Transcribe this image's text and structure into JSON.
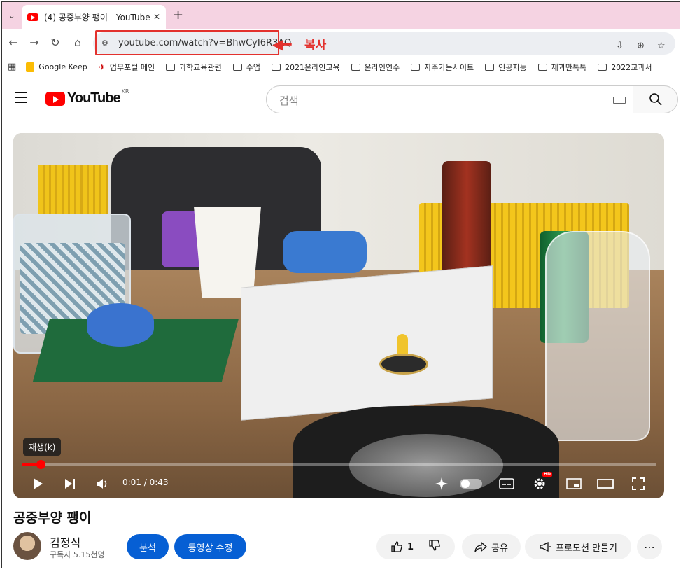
{
  "browser": {
    "tab_title": "(4) 공중부양 팽이 - YouTube",
    "tab_close": "✕",
    "new_tab": "+",
    "url": "youtube.com/watch?v=BhwCyI6R3AQ",
    "annotation": {
      "arrow": "◀━",
      "label": "복사",
      "color": "#e3312d"
    },
    "bookmarks": [
      {
        "label": "Google Keep",
        "icon": "keep-icon"
      },
      {
        "label": "업무포털 메인",
        "icon": "pin-icon"
      },
      {
        "label": "과학교육관련",
        "icon": "folder-icon"
      },
      {
        "label": "수업",
        "icon": "folder-icon"
      },
      {
        "label": "2021온라인교육",
        "icon": "folder-icon"
      },
      {
        "label": "온라인연수",
        "icon": "folder-icon"
      },
      {
        "label": "자주가는사이트",
        "icon": "folder-icon"
      },
      {
        "label": "인공지능",
        "icon": "folder-icon"
      },
      {
        "label": "재과만톡톡",
        "icon": "folder-icon"
      },
      {
        "label": "2022교과서",
        "icon": "folder-icon"
      }
    ]
  },
  "youtube": {
    "logo_text": "YouTube",
    "region": "KR",
    "search_placeholder": "검색",
    "brand_color": "#ff0000"
  },
  "player": {
    "tooltip": "재생(k)",
    "time": "0:01 / 0:43",
    "progress_fraction": 0.03,
    "hd_badge": "HD"
  },
  "video": {
    "title": "공중부양 팽이",
    "channel": "김정식",
    "subscribers": "구독자 5.15천명",
    "buttons": {
      "analytics": "분석",
      "edit": "동영상 수정",
      "like_count": "1",
      "share": "공유",
      "promote": "프로모션 만들기",
      "more": "⋯"
    },
    "accent_blue": "#065fd4"
  }
}
